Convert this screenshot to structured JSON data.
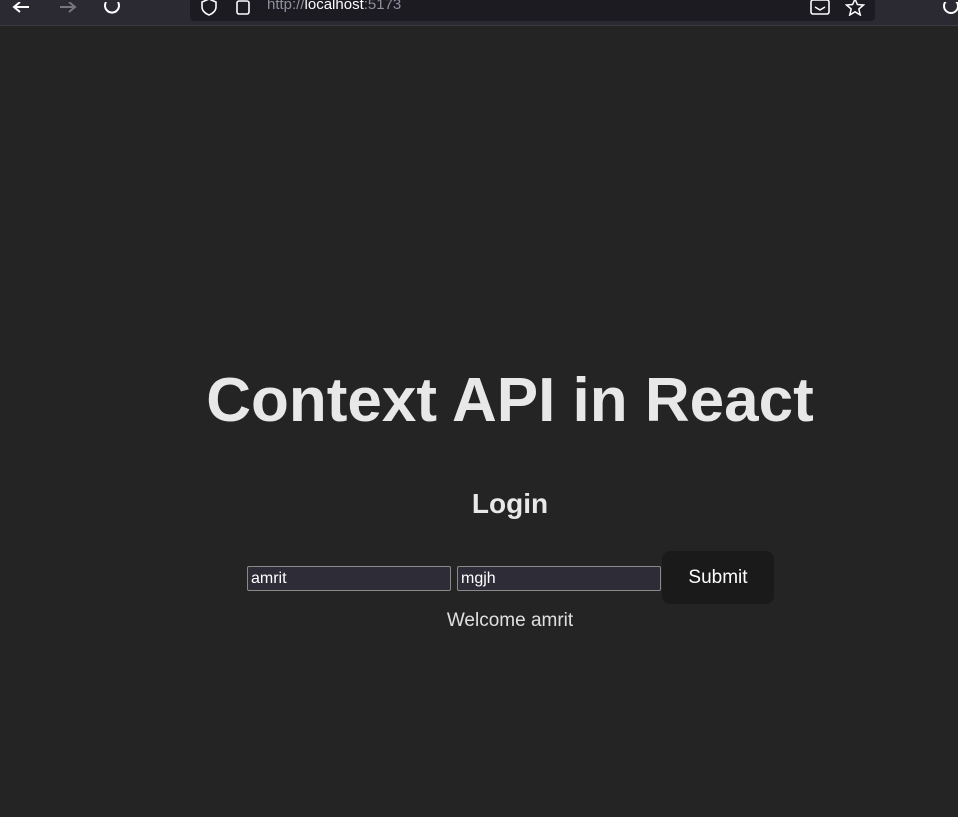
{
  "browser": {
    "url_scheme": "http://",
    "url_host": "localhost",
    "url_port": ":5173",
    "icons": [
      "back-arrow-icon",
      "forward-arrow-icon",
      "reload-icon",
      "shield-icon",
      "page-icon",
      "reader-view-icon",
      "star-icon",
      "account-icon"
    ],
    "colors": {
      "toolbar": "#2b2a33",
      "urlbar": "#1c1b22"
    }
  },
  "page": {
    "title": "Context API in React",
    "subtitle": "Login",
    "username_value": "amrit",
    "password_value": "mgjh",
    "submit_label": "Submit",
    "welcome_text": "Welcome amrit",
    "colors": {
      "background": "#242424",
      "button": "#1a1a1a",
      "input": "#2e2c37"
    }
  }
}
